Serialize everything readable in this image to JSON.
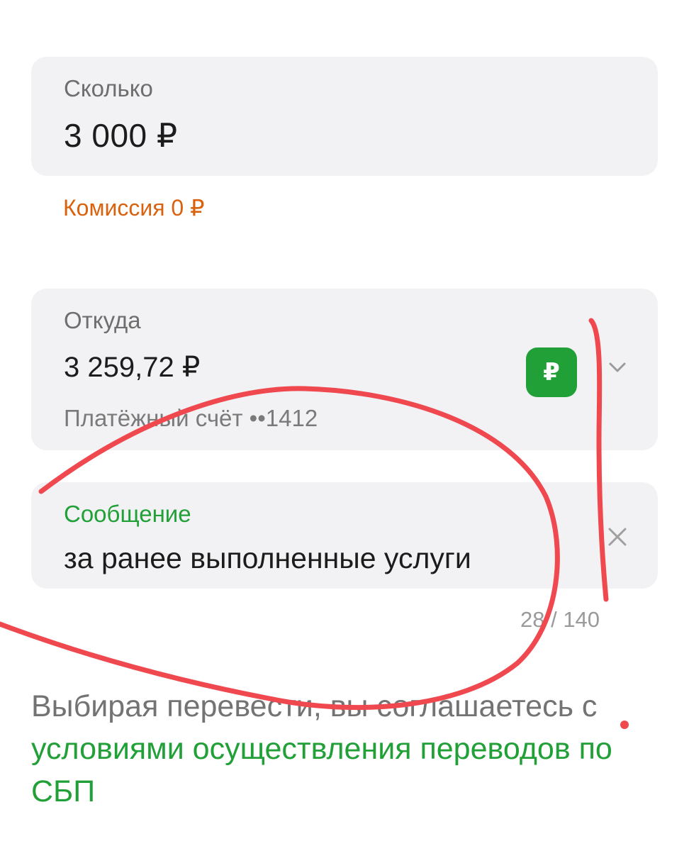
{
  "amount": {
    "label": "Сколько",
    "value": "3 000 ₽"
  },
  "commission": {
    "text": "Комиссия 0 ₽"
  },
  "from": {
    "label": "Откуда",
    "balance": "3 259,72 ₽",
    "account": "Платёжный счёт ••1412",
    "badge": "₽",
    "badge_color": "#21a038"
  },
  "message": {
    "label": "Сообщение",
    "value": "за ранее выполненные услуги",
    "counter": "28 / 140"
  },
  "terms": {
    "prefix": "Выбирая перевести, вы соглашаетесь с ",
    "link": "условиями осуществления переводов по СБП"
  },
  "colors": {
    "accent": "#21a038",
    "commission": "#d9620f",
    "annotation": "#f0484f"
  }
}
